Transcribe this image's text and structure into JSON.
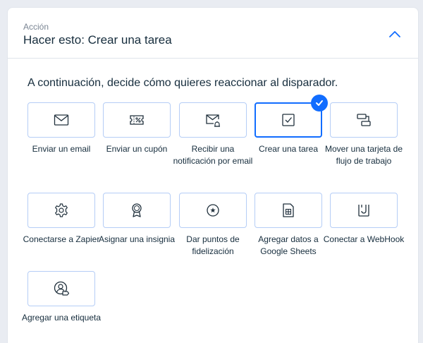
{
  "header": {
    "subtitle": "Acción",
    "title": "Hacer esto: Crear una tarea"
  },
  "prompt": "A continuación, decide cómo quieres reaccionar al disparador.",
  "accent_color": "#116dff",
  "tile_border_color": "#b5cdf6",
  "actions": [
    {
      "label": "Enviar un email",
      "icon": "envelope-icon",
      "selected": false
    },
    {
      "label": "Enviar un cupón",
      "icon": "coupon-icon",
      "selected": false
    },
    {
      "label": "Recibir una notificación por email",
      "icon": "email-notification-icon",
      "selected": false
    },
    {
      "label": "Crear una tarea",
      "icon": "checkbox-icon",
      "selected": true
    },
    {
      "label": "Mover una tarjeta de flujo de trabajo",
      "icon": "workflow-card-icon",
      "selected": false
    },
    {
      "label": "Conectarse a Zapier",
      "icon": "gear-icon",
      "selected": false
    },
    {
      "label": "Asignar una insignia",
      "icon": "badge-icon",
      "selected": false
    },
    {
      "label": "Dar puntos de fidelización",
      "icon": "loyalty-points-icon",
      "selected": false
    },
    {
      "label": "Agregar datos a Google Sheets",
      "icon": "sheets-icon",
      "selected": false
    },
    {
      "label": "Conectar a WebHook",
      "icon": "webhook-icon",
      "selected": false
    },
    {
      "label": "Agregar una etiqueta",
      "icon": "contact-tag-icon",
      "selected": false
    }
  ]
}
